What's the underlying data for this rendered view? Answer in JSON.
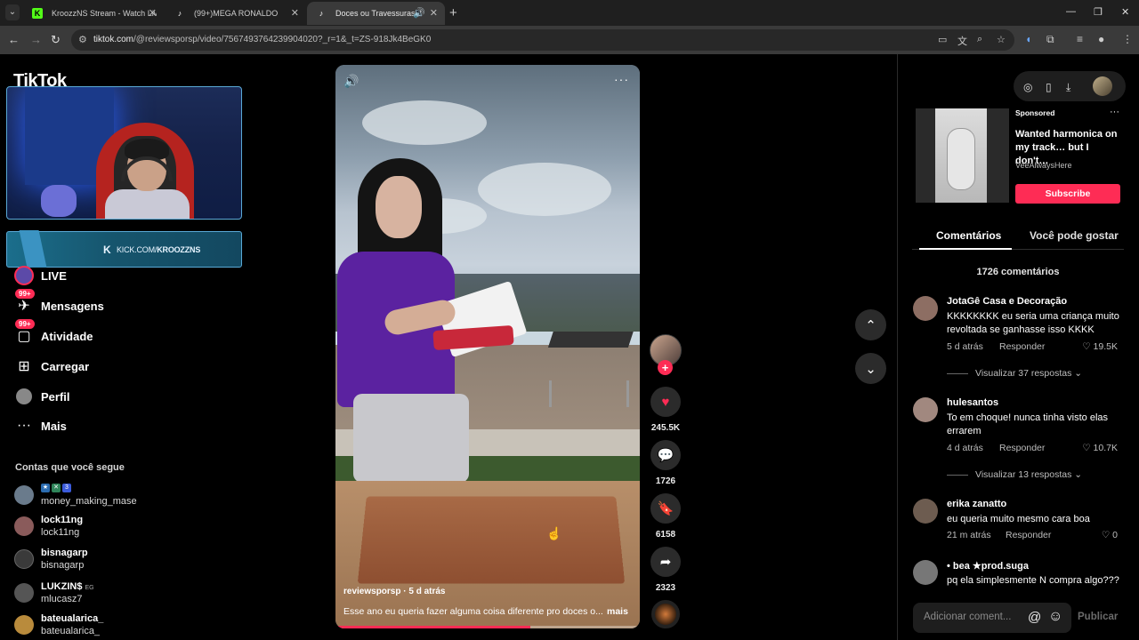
{
  "browser": {
    "tabs": [
      {
        "label": "KroozzNS Stream - Watch Live",
        "icon": "kick-icon",
        "active": false
      },
      {
        "label": "(99+)MEGA RONALDO",
        "icon": "tiktok-icon",
        "active": false
      },
      {
        "label": "Doces ou Travessuras: Snow",
        "icon": "tiktok-icon",
        "active": true
      }
    ],
    "new_tab": "+",
    "url_host": "tiktok.com",
    "url_path": "/@reviewsporsp/video/7567493764239904020?_r=1&_t=ZS-918Jk4BeGK0"
  },
  "sidebar": {
    "logo": "TikTok",
    "stream_overlay": {
      "kick_prefix": "KICK.COM/",
      "kick_channel": "KROOZZNS"
    },
    "nav": [
      {
        "label": "LIVE",
        "icon": "live-icon"
      },
      {
        "label": "Mensagens",
        "icon": "messages-icon",
        "badge": "99+"
      },
      {
        "label": "Atividade",
        "icon": "activity-icon",
        "badge": "99+"
      },
      {
        "label": "Carregar",
        "icon": "upload-icon"
      },
      {
        "label": "Perfil",
        "icon": "profile-icon"
      },
      {
        "label": "Mais",
        "icon": "more-icon"
      }
    ],
    "following_title": "Contas que você segue",
    "following": [
      {
        "name1": "",
        "name2": "money_making_mase",
        "color": "#6a7b8c"
      },
      {
        "name1": "lock11ng",
        "name2": "lock11ng",
        "color": "#8a5b5b"
      },
      {
        "name1": "bisnagarp",
        "name2": "bisnagarp",
        "color": "#3a3a3a"
      },
      {
        "name1": "LUKZIN$",
        "tag": "EG",
        "name2": "mlucasz7",
        "color": "#555"
      },
      {
        "name1": "bateualarica_",
        "name2": "bateualarica_",
        "color": "#b98b3c"
      }
    ]
  },
  "video": {
    "author": "reviewsporsp · 5 d atrás",
    "caption": "Esse ano eu queria fazer alguma coisa diferente pro doces o...",
    "more": "mais",
    "progress": 0.64,
    "likes": "245.5K",
    "comments": "1726",
    "saves": "6158",
    "shares": "2323",
    "follow_plus": "+"
  },
  "right_panel": {
    "ad": {
      "sponsored": "Sponsored",
      "title": "Wanted harmonica on my track… but I don't…",
      "brand": "VeeAlwaysHere",
      "subscribe": "Subscribe"
    },
    "tabs": [
      "Comentários",
      "Você pode gostar"
    ],
    "comment_count": "1726 comentários",
    "comments": [
      {
        "user": "JotaGê Casa e Decoração",
        "text": "KKKKKKKK eu seria uma criança muito revoltada se ganhasse isso KKKK",
        "time": "5 d atrás",
        "reply": "Responder",
        "likes": "19.5K",
        "view": "Visualizar 37 respostas",
        "color": "#8d6e63"
      },
      {
        "user": "hulesantos",
        "text": "To em choque! nunca tinha visto elas errarem",
        "time": "4 d atrás",
        "reply": "Responder",
        "likes": "10.7K",
        "view": "Visualizar 13 respostas",
        "color": "#a1887f"
      },
      {
        "user": "erika zanatto",
        "text": "eu queria muito mesmo cara boa",
        "time": "21 m atrás",
        "reply": "Responder",
        "likes": "0",
        "view": "",
        "color": "#6d5c50"
      },
      {
        "user": "• bea ★prod.suga",
        "text": "pq ela simplesmente N compra algo???",
        "time": "",
        "reply": "",
        "likes": "",
        "view": "",
        "color": "#777"
      }
    ],
    "input_placeholder": "Adicionar coment...",
    "publish": "Publicar"
  }
}
